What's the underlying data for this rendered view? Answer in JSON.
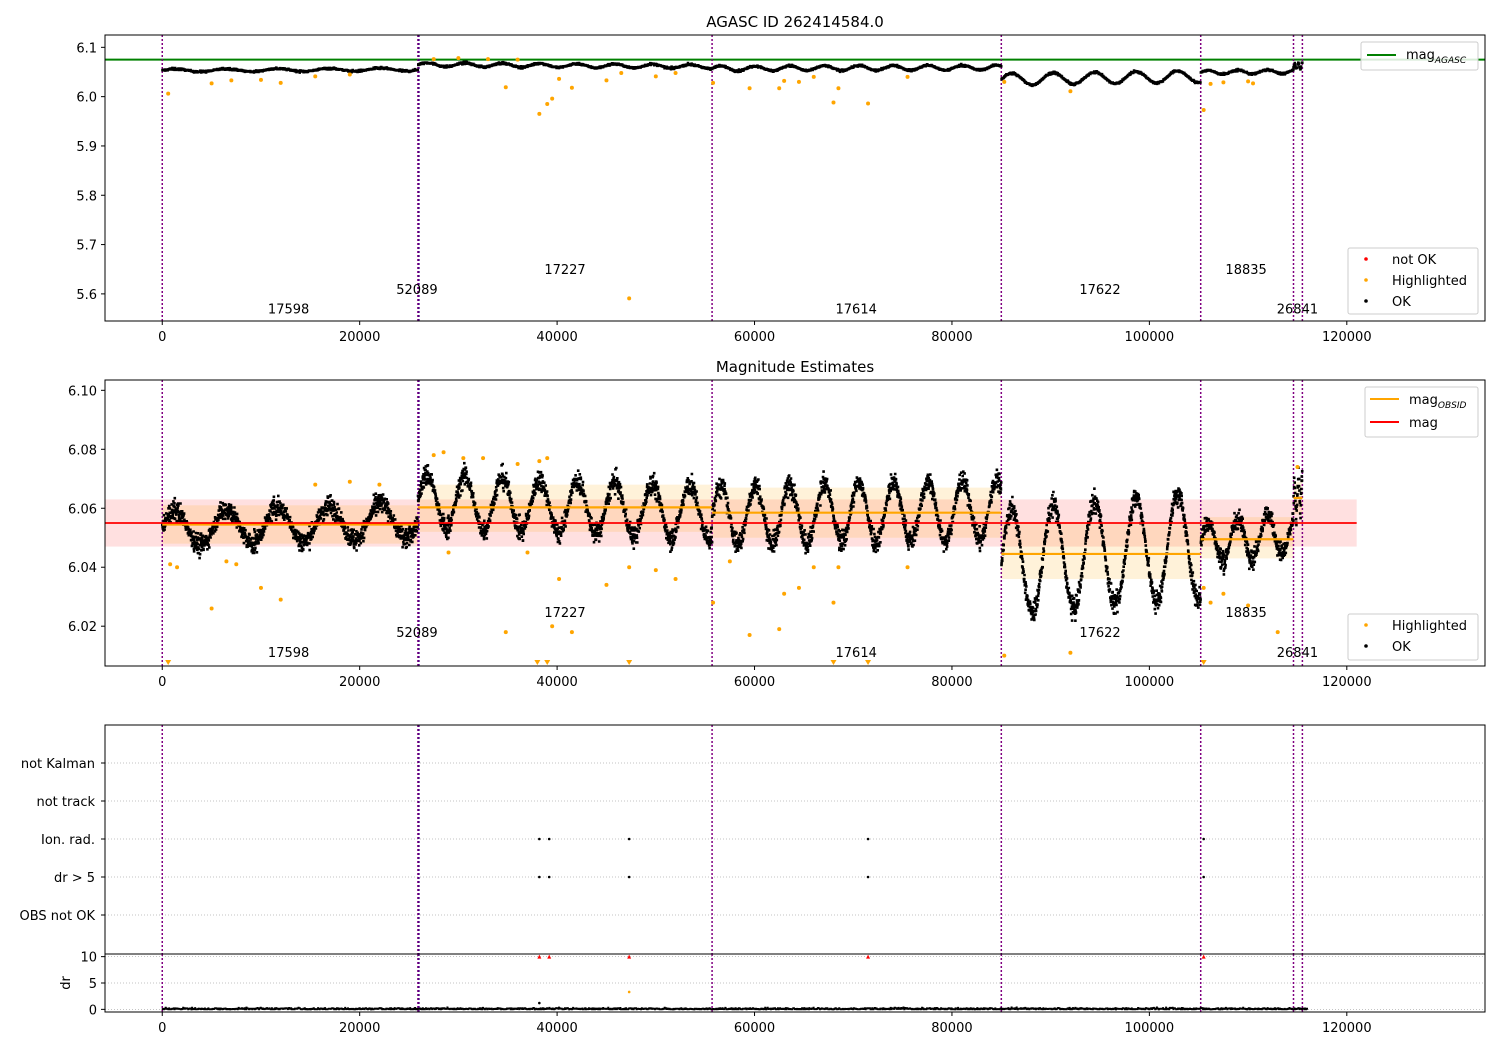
{
  "chart_data": [
    {
      "id": "top",
      "type": "scatter",
      "title": "AGASC ID 262414584.0",
      "xlim": [
        -5800,
        134000
      ],
      "ylim": [
        5.545,
        6.125
      ],
      "xticks": [
        0,
        20000,
        40000,
        60000,
        80000,
        100000,
        120000
      ],
      "yticks": [
        5.6,
        5.7,
        5.8,
        5.9,
        6.0,
        6.1
      ],
      "ytick_labels": [
        "5.6",
        "5.7",
        "5.8",
        "5.9",
        "6.0",
        "6.1"
      ],
      "reference_lines": [
        {
          "name": "mag",
          "subscript": "AGASC",
          "y": 6.075,
          "x_range": [
            -5800,
            134000
          ],
          "color": "#008000"
        }
      ],
      "segments": [
        {
          "x0": 0,
          "x1": 25900,
          "base": 6.054,
          "amp": 0.003,
          "period": 5200,
          "trend": 0.002
        },
        {
          "x0": 25900,
          "x1": 55700,
          "base": 6.063,
          "amp": 0.004,
          "period": 3800,
          "trend": -0.004
        },
        {
          "x0": 55700,
          "x1": 85000,
          "base": 6.058,
          "amp": 0.005,
          "period": 3500,
          "trend": 0.002
        },
        {
          "x0": 85000,
          "x1": 105200,
          "base": 6.038,
          "amp": 0.012,
          "period": 4200,
          "trend": 0.006
        },
        {
          "x0": 105200,
          "x1": 114600,
          "base": 6.05,
          "amp": 0.004,
          "period": 3000,
          "trend": 0.002
        },
        {
          "x0": 114600,
          "x1": 115500,
          "base": 6.062,
          "amp": 0.006,
          "period": 400,
          "trend": 0.005
        }
      ],
      "highlighted_points": [
        [
          600,
          6.006
        ],
        [
          5000,
          6.027
        ],
        [
          7000,
          6.033
        ],
        [
          10000,
          6.034
        ],
        [
          12000,
          6.028
        ],
        [
          15500,
          6.041
        ],
        [
          19000,
          6.045
        ],
        [
          27500,
          6.076
        ],
        [
          30000,
          6.078
        ],
        [
          33000,
          6.076
        ],
        [
          34800,
          6.019
        ],
        [
          36000,
          6.075
        ],
        [
          38200,
          5.965
        ],
        [
          39000,
          5.985
        ],
        [
          39500,
          5.996
        ],
        [
          40200,
          6.036
        ],
        [
          41500,
          6.018
        ],
        [
          45000,
          6.033
        ],
        [
          46500,
          6.048
        ],
        [
          47300,
          5.591
        ],
        [
          50000,
          6.041
        ],
        [
          52000,
          6.048
        ],
        [
          55800,
          6.028
        ],
        [
          59500,
          6.017
        ],
        [
          62500,
          6.017
        ],
        [
          63000,
          6.032
        ],
        [
          64500,
          6.03
        ],
        [
          66000,
          6.04
        ],
        [
          68000,
          5.988
        ],
        [
          68500,
          6.017
        ],
        [
          71500,
          5.986
        ],
        [
          75500,
          6.04
        ],
        [
          85300,
          6.03
        ],
        [
          92000,
          6.011
        ],
        [
          105500,
          5.973
        ],
        [
          106200,
          6.026
        ],
        [
          107500,
          6.029
        ],
        [
          110000,
          6.031
        ],
        [
          110500,
          6.027
        ]
      ],
      "obsid_labels": [
        {
          "text": "17598",
          "x": 12800,
          "y": 5.56
        },
        {
          "text": "52089",
          "x": 25800,
          "y": 5.6
        },
        {
          "text": "17227",
          "x": 40800,
          "y": 5.64
        },
        {
          "text": "17614",
          "x": 70300,
          "y": 5.56
        },
        {
          "text": "17622",
          "x": 95000,
          "y": 5.6
        },
        {
          "text": "18835",
          "x": 109800,
          "y": 5.64
        },
        {
          "text": "26841",
          "x": 115000,
          "y": 5.56
        }
      ],
      "legend_upper": [
        {
          "label": "mag",
          "subscript": "AGASC",
          "color": "#008000",
          "marker": "line"
        }
      ],
      "legend_lower": [
        {
          "label": "not OK",
          "color": "#ff0000",
          "marker": "dot"
        },
        {
          "label": "Highlighted",
          "color": "#ffa500",
          "marker": "dot"
        },
        {
          "label": "OK",
          "color": "#000000",
          "marker": "dot"
        }
      ]
    },
    {
      "id": "middle",
      "type": "scatter",
      "title": "Magnitude Estimates",
      "xlim": [
        -5800,
        134000
      ],
      "ylim": [
        6.0065,
        6.1035
      ],
      "xticks": [
        0,
        20000,
        40000,
        60000,
        80000,
        100000,
        120000
      ],
      "yticks": [
        6.02,
        6.04,
        6.06,
        6.08,
        6.1
      ],
      "ytick_labels": [
        "6.02",
        "6.04",
        "6.06",
        "6.08",
        "6.10"
      ],
      "mag": {
        "y": 6.055,
        "band": [
          6.047,
          6.063
        ],
        "x_range": [
          -5800,
          121000
        ],
        "color": "#ff0000"
      },
      "mag_obsid": [
        {
          "x0": 0,
          "x1": 25900,
          "y": 6.0545,
          "band": [
            6.048,
            6.061
          ]
        },
        {
          "x0": 25900,
          "x1": 55700,
          "y": 6.0603,
          "band": [
            6.052,
            6.068
          ]
        },
        {
          "x0": 55700,
          "x1": 85000,
          "y": 6.0585,
          "band": [
            6.05,
            6.067
          ]
        },
        {
          "x0": 85000,
          "x1": 105200,
          "y": 6.0445,
          "band": [
            6.036,
            6.055
          ]
        },
        {
          "x0": 105200,
          "x1": 114600,
          "y": 6.0495,
          "band": [
            6.043,
            6.057
          ]
        },
        {
          "x0": 114600,
          "x1": 115500,
          "y": 6.0635,
          "band": [
            6.058,
            6.069
          ]
        }
      ],
      "segments": [
        {
          "x0": 0,
          "x1": 25900,
          "base": 6.0545,
          "amp": 0.006,
          "period": 5200,
          "trend": 0.003
        },
        {
          "x0": 25900,
          "x1": 55700,
          "base": 6.0605,
          "amp": 0.009,
          "period": 3800,
          "trend": -0.004
        },
        {
          "x0": 55700,
          "x1": 85000,
          "base": 6.0585,
          "amp": 0.01,
          "period": 3500,
          "trend": 0.002
        },
        {
          "x0": 85000,
          "x1": 105200,
          "base": 6.0445,
          "amp": 0.018,
          "period": 4200,
          "trend": 0.006
        },
        {
          "x0": 105200,
          "x1": 114600,
          "base": 6.05,
          "amp": 0.007,
          "period": 3000,
          "trend": 0.004
        },
        {
          "x0": 114600,
          "x1": 115500,
          "base": 6.064,
          "amp": 0.006,
          "period": 400,
          "trend": 0.006
        }
      ],
      "highlighted_points": [
        [
          800,
          6.041
        ],
        [
          1500,
          6.04
        ],
        [
          5000,
          6.026
        ],
        [
          6500,
          6.042
        ],
        [
          7500,
          6.041
        ],
        [
          10000,
          6.033
        ],
        [
          12000,
          6.029
        ],
        [
          15500,
          6.068
        ],
        [
          19000,
          6.069
        ],
        [
          22000,
          6.068
        ],
        [
          27500,
          6.078
        ],
        [
          28500,
          6.079
        ],
        [
          29000,
          6.045
        ],
        [
          30500,
          6.077
        ],
        [
          32500,
          6.077
        ],
        [
          34800,
          6.018
        ],
        [
          36000,
          6.075
        ],
        [
          37000,
          6.045
        ],
        [
          38200,
          6.076
        ],
        [
          39000,
          6.077
        ],
        [
          39500,
          6.02
        ],
        [
          40200,
          6.036
        ],
        [
          41500,
          6.018
        ],
        [
          45000,
          6.034
        ],
        [
          47300,
          6.04
        ],
        [
          50000,
          6.039
        ],
        [
          52000,
          6.036
        ],
        [
          55800,
          6.028
        ],
        [
          57500,
          6.042
        ],
        [
          59500,
          6.017
        ],
        [
          62500,
          6.019
        ],
        [
          63000,
          6.031
        ],
        [
          64500,
          6.033
        ],
        [
          66000,
          6.04
        ],
        [
          68000,
          6.028
        ],
        [
          68500,
          6.04
        ],
        [
          75500,
          6.04
        ],
        [
          85300,
          6.01
        ],
        [
          92000,
          6.011
        ],
        [
          105500,
          6.033
        ],
        [
          106200,
          6.028
        ],
        [
          107500,
          6.031
        ],
        [
          110000,
          6.027
        ],
        [
          113000,
          6.018
        ],
        [
          115000,
          6.074
        ]
      ],
      "offscale_low_points": [
        600,
        38000,
        39000,
        47300,
        68000,
        71500,
        105500
      ],
      "obsid_labels": [
        {
          "text": "17598",
          "x": 12800,
          "y": 6.0095
        },
        {
          "text": "52089",
          "x": 25800,
          "y": 6.0163
        },
        {
          "text": "17227",
          "x": 40800,
          "y": 6.0232
        },
        {
          "text": "17614",
          "x": 70300,
          "y": 6.0095
        },
        {
          "text": "17622",
          "x": 95000,
          "y": 6.0163
        },
        {
          "text": "18835",
          "x": 109800,
          "y": 6.0232
        },
        {
          "text": "26841",
          "x": 115000,
          "y": 6.0095
        }
      ],
      "legend_upper": [
        {
          "label": "mag",
          "subscript": "OBSID",
          "color": "#ffa500",
          "marker": "line"
        },
        {
          "label": "mag",
          "color": "#ff0000",
          "marker": "line"
        }
      ],
      "legend_lower": [
        {
          "label": "Highlighted",
          "color": "#ffa500",
          "marker": "dot"
        },
        {
          "label": "OK",
          "color": "#000000",
          "marker": "dot"
        }
      ]
    },
    {
      "id": "flags",
      "type": "scatter",
      "xlim": [
        -5800,
        134000
      ],
      "categories": [
        "not Kalman",
        "not track",
        "Ion. rad.",
        "dr > 5",
        "OBS not OK"
      ],
      "flag_points": [
        {
          "category": "Ion. rad.",
          "x": [
            38200,
            39200,
            47300,
            71500,
            105500
          ]
        },
        {
          "category": "dr > 5",
          "x": [
            38200,
            39200,
            47300,
            71500,
            105500
          ]
        }
      ]
    },
    {
      "id": "dr",
      "type": "scatter",
      "ylabel": "dr",
      "xlim": [
        -5800,
        134000
      ],
      "ylim": [
        -0.5,
        10.5
      ],
      "xticks": [
        0,
        20000,
        40000,
        60000,
        80000,
        100000,
        120000
      ],
      "xtick_labels": [
        "0",
        "20000",
        "40000",
        "60000",
        "80000",
        "100000",
        "120000"
      ],
      "yticks": [
        0,
        5,
        10
      ],
      "ytick_labels": [
        "0",
        "5",
        "10"
      ],
      "outliers_black": [
        [
          38200,
          1.2
        ]
      ],
      "outliers_orange": [
        [
          47300,
          3.3
        ]
      ],
      "capped_red": [
        38200,
        39200,
        47300,
        71500,
        105500
      ],
      "cap_value": 10
    }
  ],
  "observation_boundaries": [
    {
      "x": 0,
      "color": "#800080"
    },
    {
      "x": 25900,
      "color": "#800080"
    },
    {
      "x": 26000,
      "color": "#4b0082"
    },
    {
      "x": 55700,
      "color": "#800080"
    },
    {
      "x": 85000,
      "color": "#800080"
    },
    {
      "x": 105200,
      "color": "#800080"
    },
    {
      "x": 114600,
      "color": "#800080"
    },
    {
      "x": 115500,
      "color": "#800080"
    }
  ]
}
